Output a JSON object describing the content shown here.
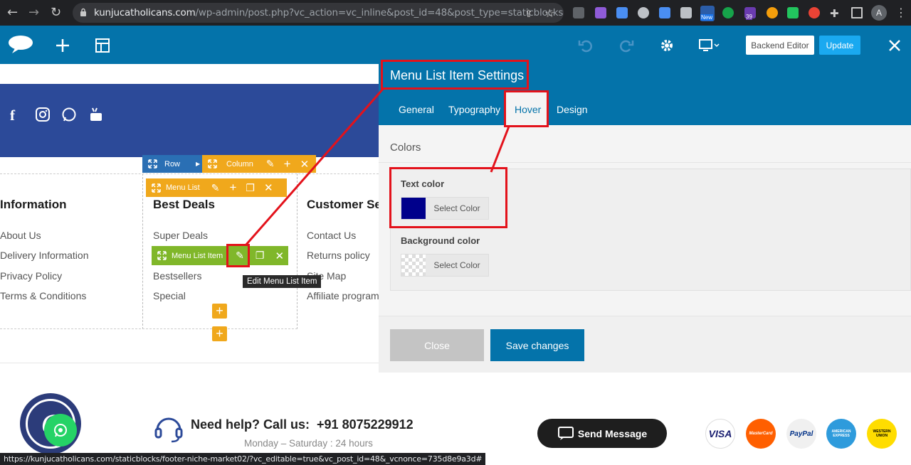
{
  "browser": {
    "url_host": "kunjucatholicans.com",
    "url_rest": "/wp-admin/post.php?vc_action=vc_inline&post_id=48&post_type=staticblocks",
    "ext_badge": "39",
    "ext_new_label": "New",
    "avatar_letter": "A"
  },
  "vc_toolbar": {
    "backend_editor_label": "Backend Editor",
    "update_label": "Update"
  },
  "page": {
    "controls": {
      "row_label": "Row",
      "column_label": "Column",
      "menu_list_label": "Menu List",
      "menu_list_item_label": "Menu List Item",
      "tooltip": "Edit Menu List Item"
    },
    "columns": [
      {
        "heading": "Information",
        "links": [
          "About Us",
          "Delivery Information",
          "Privacy Policy",
          "Terms & Conditions"
        ]
      },
      {
        "heading": "Best Deals",
        "links": [
          "Super Deals",
          "Bestsellers",
          "Special"
        ]
      },
      {
        "heading": "Customer Ser",
        "links": [
          "Contact Us",
          "Returns policy",
          "Site Map",
          "Affiliate program"
        ]
      }
    ]
  },
  "panel": {
    "title": "Menu List Item Settings",
    "tabs": [
      "General",
      "Typography",
      "Hover",
      "Design"
    ],
    "active_tab": "Hover",
    "section_title": "Colors",
    "text_color_label": "Text color",
    "text_color_value": "#00008b",
    "background_color_label": "Background color",
    "select_color_label": "Select Color",
    "close_label": "Close",
    "save_label": "Save changes"
  },
  "footer": {
    "help_text": "Need help? Call us:  +91 8075229912",
    "hours_text": "Monday – Saturday : 24 hours",
    "send_message_label": "Send Message",
    "payments": [
      "VISA",
      "MasterCard",
      "PayPal",
      "AMERICAN EXPRESS",
      "WESTERN UNION"
    ]
  },
  "status_url": "https://kunjucatholicans.com/staticblocks/footer-niche-market02/?vc_editable=true&vc_post_id=48&_vcnonce=735d8e9a3d#",
  "colors": {
    "toolbar_blue": "#0473aa",
    "header_blue": "#2c4a99",
    "control_orange": "#f0a81c",
    "control_green": "#80b72a",
    "control_blue": "#2a6fb4",
    "annotation_red": "#e3121b",
    "save_blue": "#0473aa"
  }
}
